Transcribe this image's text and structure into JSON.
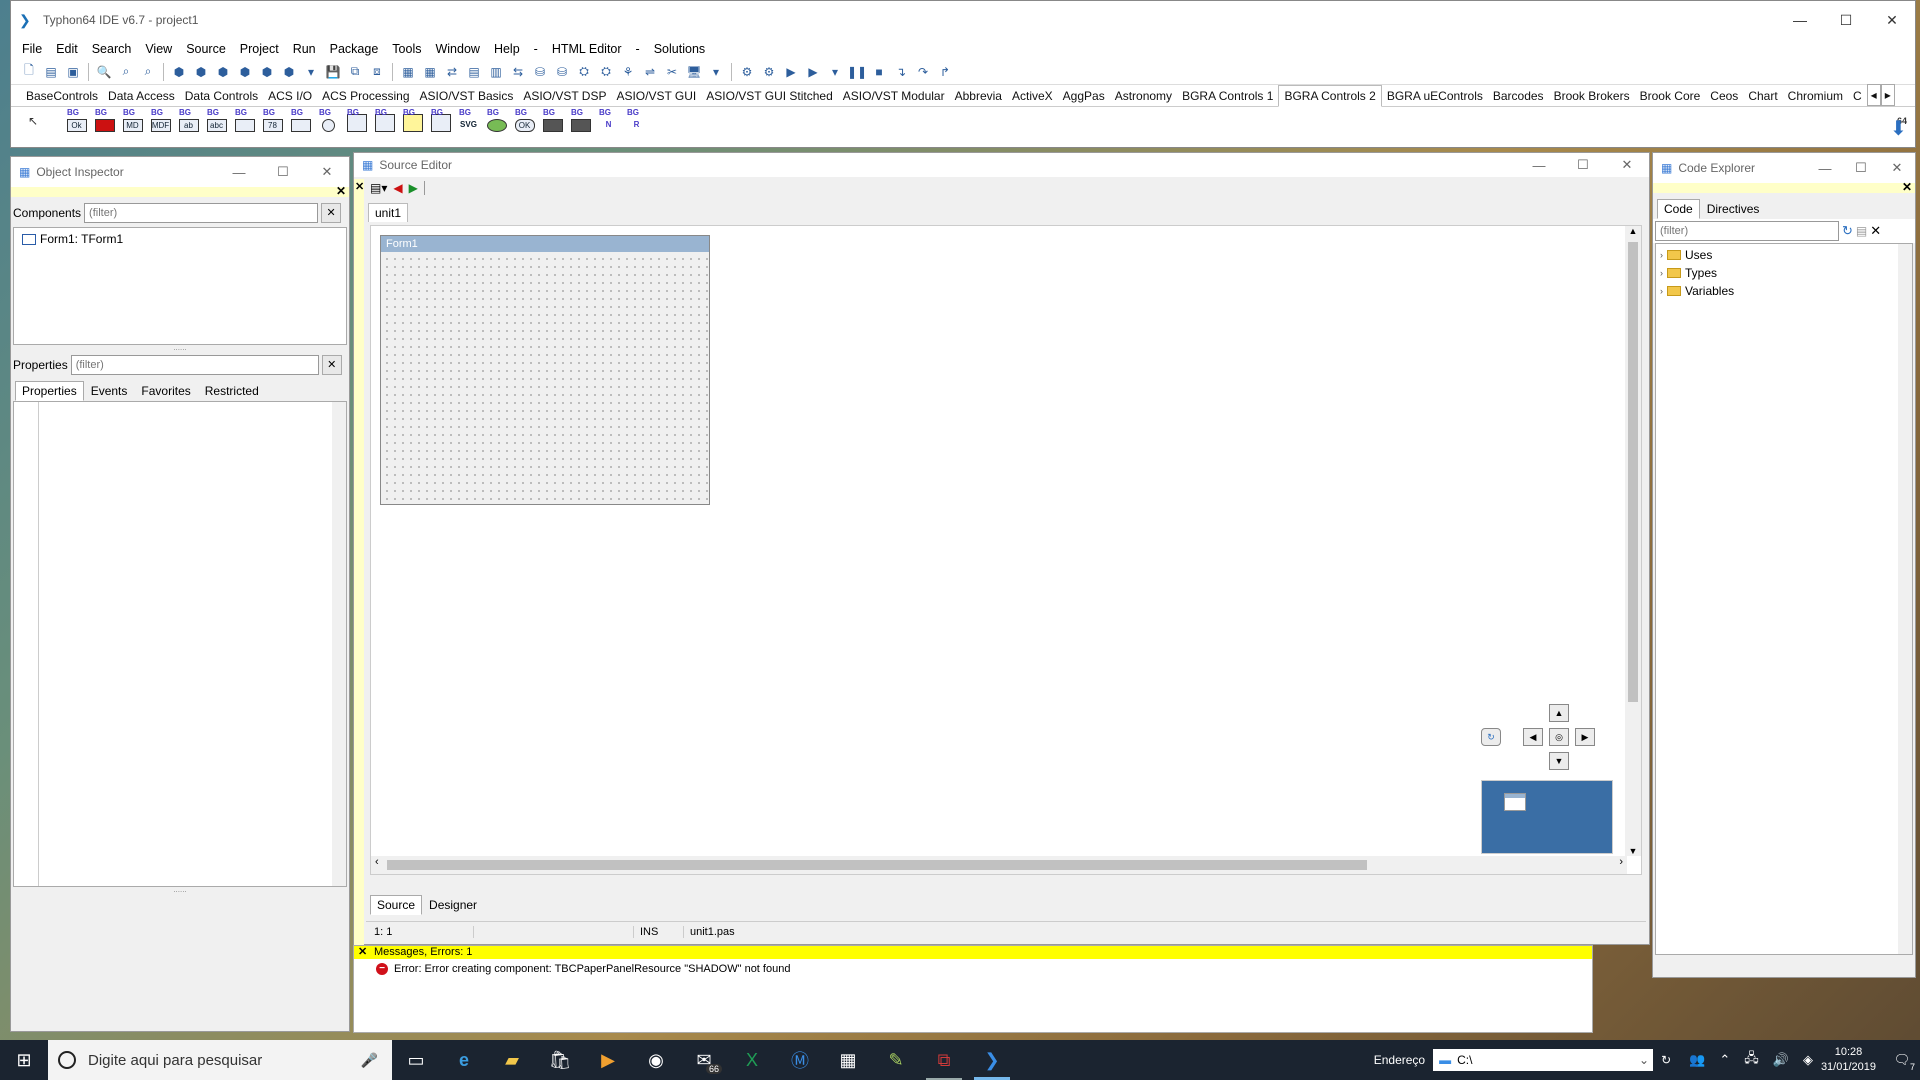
{
  "window": {
    "title": "Typhon64 IDE v6.7 - project1",
    "minimize": "—",
    "maximize": "☐",
    "close": "✕"
  },
  "menu": [
    "File",
    "Edit",
    "Search",
    "View",
    "Source",
    "Project",
    "Run",
    "Package",
    "Tools",
    "Window",
    "Help",
    "-",
    "HTML Editor",
    "-",
    "Solutions"
  ],
  "palette": {
    "tabs": [
      "BaseControls",
      "Data Access",
      "Data Controls",
      "ACS I/O",
      "ACS Processing",
      "ASIO/VST Basics",
      "ASIO/VST DSP",
      "ASIO/VST GUI",
      "ASIO/VST GUI Stitched",
      "ASIO/VST Modular",
      "Abbrevia",
      "ActiveX",
      "AggPas",
      "Astronomy",
      "BGRA Controls 1",
      "BGRA Controls 2",
      "BGRA uEControls",
      "Barcodes",
      "Brook Brokers",
      "Brook Core",
      "Ceos",
      "Chart",
      "Chromium",
      "C"
    ],
    "active_tab": "BGRA Controls 2",
    "icon_bg": "BG",
    "icons": [
      "Ok",
      "",
      "MD",
      "MDF",
      "ab",
      "abc",
      "",
      "78",
      "",
      "",
      "",
      "",
      "",
      "",
      "SVG",
      "",
      "OK",
      "",
      "",
      "N",
      "R"
    ],
    "bitness": "64"
  },
  "object_inspector": {
    "title": "Object Inspector",
    "components_label": "Components",
    "filter_placeholder": "(filter)",
    "tree_item": "Form1: TForm1",
    "properties_label": "Properties",
    "tabs": [
      "Properties",
      "Events",
      "Favorites",
      "Restricted"
    ]
  },
  "source_editor": {
    "title": "Source Editor",
    "file_tab": "unit1",
    "form_caption": "Form1",
    "bottom_tabs": [
      "Source",
      "Designer"
    ],
    "status": {
      "position": "1:   1",
      "mode": "INS",
      "file": "unit1.pas"
    }
  },
  "code_explorer": {
    "title": "Code Explorer",
    "tabs": [
      "Code",
      "Directives"
    ],
    "filter_placeholder": "(filter)",
    "tree": [
      "Uses",
      "Types",
      "Variables"
    ]
  },
  "messages": {
    "title": "Messages, Errors: 1",
    "error": "Error: Error creating component: TBCPaperPanelResource \"SHADOW\" not found"
  },
  "taskbar": {
    "search_placeholder": "Digite aqui para pesquisar",
    "mail_badge": "66",
    "address_label": "Endereço",
    "address_value": "C:\\",
    "time": "10:28",
    "date": "31/01/2019",
    "notifications": "7"
  }
}
